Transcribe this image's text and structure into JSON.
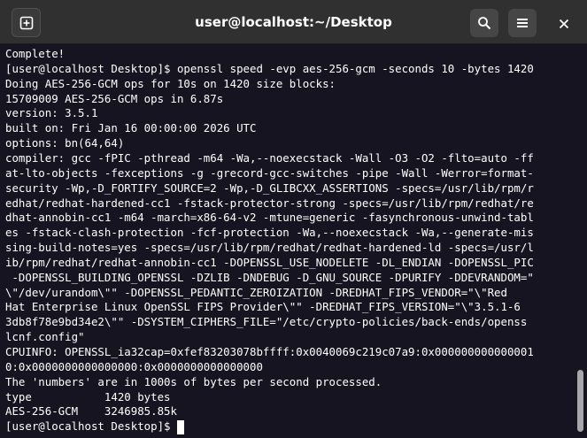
{
  "window": {
    "title": "user@localhost:~/Desktop"
  },
  "header": {
    "new_tab_icon": "new-tab-icon",
    "search_icon": "search-icon",
    "menu_icon": "hamburger-menu-icon",
    "close_icon": "close-icon"
  },
  "terminal": {
    "lines": [
      "Complete!",
      "[user@localhost Desktop]$ openssl speed -evp aes-256-gcm -seconds 10 -bytes 1420",
      "Doing AES-256-GCM ops for 10s on 1420 size blocks:",
      "15709009 AES-256-GCM ops in 6.87s",
      "version: 3.5.1",
      "built on: Fri Jan 16 00:00:00 2026 UTC",
      "options: bn(64,64)",
      "compiler: gcc -fPIC -pthread -m64 -Wa,--noexecstack -Wall -O3 -O2 -flto=auto -ff",
      "at-lto-objects -fexceptions -g -grecord-gcc-switches -pipe -Wall -Werror=format-",
      "security -Wp,-D_FORTIFY_SOURCE=2 -Wp,-D_GLIBCXX_ASSERTIONS -specs=/usr/lib/rpm/r",
      "edhat/redhat-hardened-cc1 -fstack-protector-strong -specs=/usr/lib/rpm/redhat/re",
      "dhat-annobin-cc1 -m64 -march=x86-64-v2 -mtune=generic -fasynchronous-unwind-tabl",
      "es -fstack-clash-protection -fcf-protection -Wa,--noexecstack -Wa,--generate-mis",
      "sing-build-notes=yes -specs=/usr/lib/rpm/redhat/redhat-hardened-ld -specs=/usr/l",
      "ib/rpm/redhat/redhat-annobin-cc1 -DOPENSSL_USE_NODELETE -DL_ENDIAN -DOPENSSL_PIC",
      " -DOPENSSL_BUILDING_OPENSSL -DZLIB -DNDEBUG -D_GNU_SOURCE -DPURIFY -DDEVRANDOM=\"",
      "\\\"/dev/urandom\\\"\" -DOPENSSL_PEDANTIC_ZEROIZATION -DREDHAT_FIPS_VENDOR=\"\\\"Red",
      "Hat Enterprise Linux OpenSSL FIPS Provider\\\"\" -DREDHAT_FIPS_VERSION=\"\\\"3.5.1-6",
      "3db8f78e9bd34e2\\\"\" -DSYSTEM_CIPHERS_FILE=\"/etc/crypto-policies/back-ends/openss",
      "lcnf.config\"",
      "CPUINFO: OPENSSL_ia32cap=0xfef83203078bffff:0x0040069c219c07a9:0x000000000000001",
      "0:0x0000000000000000:0x0000000000000000",
      "The 'numbers' are in 1000s of bytes per second processed.",
      "type           1420 bytes",
      "AES-256-GCM    3246985.85k",
      "[user@localhost Desktop]$ "
    ]
  },
  "colors": {
    "header_bg": "#303030",
    "terminal_bg": "#171421",
    "terminal_fg": "#ffffff",
    "scroll_thumb": "#a8a8a8"
  }
}
